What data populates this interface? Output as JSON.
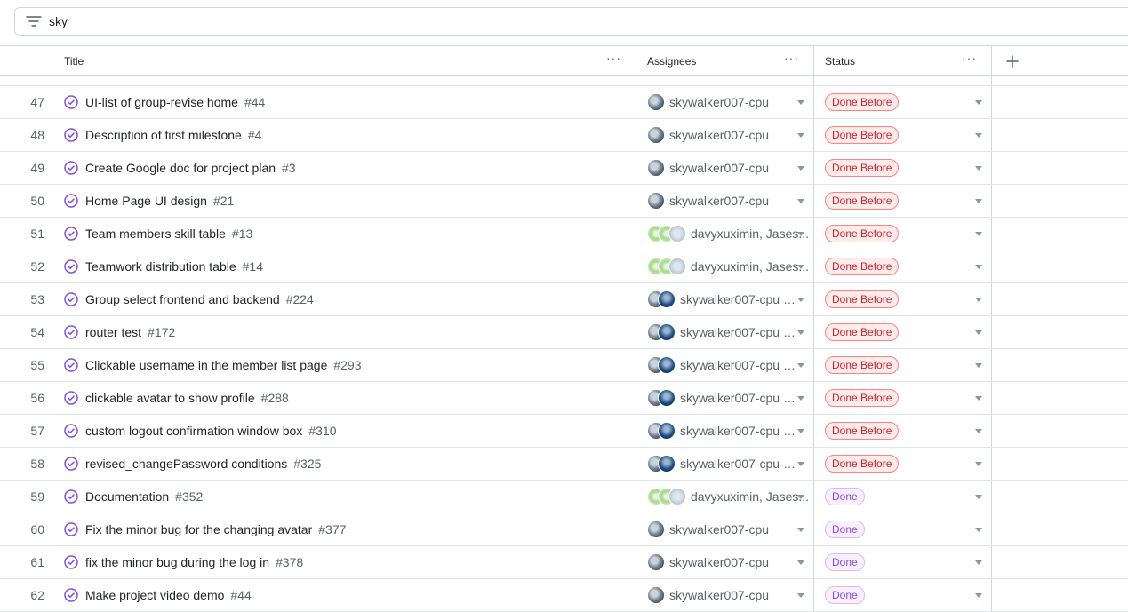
{
  "filter": {
    "icon": "filter-icon",
    "text": "sky"
  },
  "columns": {
    "title": "Title",
    "assignees": "Assignees",
    "status": "Status",
    "more": "···",
    "add": "+"
  },
  "rows": [
    {
      "num": "47",
      "title": "UI-list of group-revise home",
      "issue": "#44",
      "assignees": "skywalker007-cpu",
      "avatars": [
        "sky"
      ],
      "status": "Done Before"
    },
    {
      "num": "48",
      "title": "Description of first milestone",
      "issue": "#4",
      "assignees": "skywalker007-cpu",
      "avatars": [
        "sky"
      ],
      "status": "Done Before"
    },
    {
      "num": "49",
      "title": "Create Google doc for project plan",
      "issue": "#3",
      "assignees": "skywalker007-cpu",
      "avatars": [
        "sky"
      ],
      "status": "Done Before"
    },
    {
      "num": "50",
      "title": "Home Page UI design",
      "issue": "#21",
      "assignees": "skywalker007-cpu",
      "avatars": [
        "sky"
      ],
      "status": "Done Before"
    },
    {
      "num": "51",
      "title": "Team members skill table",
      "issue": "#13",
      "assignees": "davyxuximin, Jases...",
      "avatars": [
        "davy",
        "davy",
        "jase"
      ],
      "status": "Done Before"
    },
    {
      "num": "52",
      "title": "Teamwork distribution table",
      "issue": "#14",
      "assignees": "davyxuximin, Jases...",
      "avatars": [
        "davy",
        "davy",
        "jase"
      ],
      "status": "Done Before"
    },
    {
      "num": "53",
      "title": "Group select frontend and backend",
      "issue": "#224",
      "assignees": "skywalker007-cpu a...",
      "avatars": [
        "sky",
        "blue"
      ],
      "status": "Done Before"
    },
    {
      "num": "54",
      "title": "router test",
      "issue": "#172",
      "assignees": "skywalker007-cpu a...",
      "avatars": [
        "sky",
        "blue"
      ],
      "status": "Done Before"
    },
    {
      "num": "55",
      "title": "Clickable username in the member list page",
      "issue": "#293",
      "assignees": "skywalker007-cpu a...",
      "avatars": [
        "sky",
        "blue"
      ],
      "status": "Done Before"
    },
    {
      "num": "56",
      "title": "clickable avatar to show profile",
      "issue": "#288",
      "assignees": "skywalker007-cpu a...",
      "avatars": [
        "sky",
        "blue"
      ],
      "status": "Done Before"
    },
    {
      "num": "57",
      "title": "custom logout confirmation window box",
      "issue": "#310",
      "assignees": "skywalker007-cpu a...",
      "avatars": [
        "sky",
        "blue"
      ],
      "status": "Done Before"
    },
    {
      "num": "58",
      "title": "revised_changePassword conditions",
      "issue": "#325",
      "assignees": "skywalker007-cpu a...",
      "avatars": [
        "sky",
        "blue"
      ],
      "status": "Done Before"
    },
    {
      "num": "59",
      "title": "Documentation",
      "issue": "#352",
      "assignees": "davyxuximin, Jases...",
      "avatars": [
        "davy",
        "davy",
        "jase"
      ],
      "status": "Done"
    },
    {
      "num": "60",
      "title": "Fix the minor bug for the changing avatar",
      "issue": "#377",
      "assignees": "skywalker007-cpu",
      "avatars": [
        "sky"
      ],
      "status": "Done"
    },
    {
      "num": "61",
      "title": "fix the minor bug during the log in",
      "issue": "#378",
      "assignees": "skywalker007-cpu",
      "avatars": [
        "sky"
      ],
      "status": "Done"
    },
    {
      "num": "62",
      "title": "Make project video demo",
      "issue": "#44",
      "assignees": "skywalker007-cpu",
      "avatars": [
        "sky"
      ],
      "status": "Done"
    }
  ],
  "colors": {
    "done_before": "#cf222e",
    "done": "#8250df",
    "issue_icon": "#8250df"
  }
}
